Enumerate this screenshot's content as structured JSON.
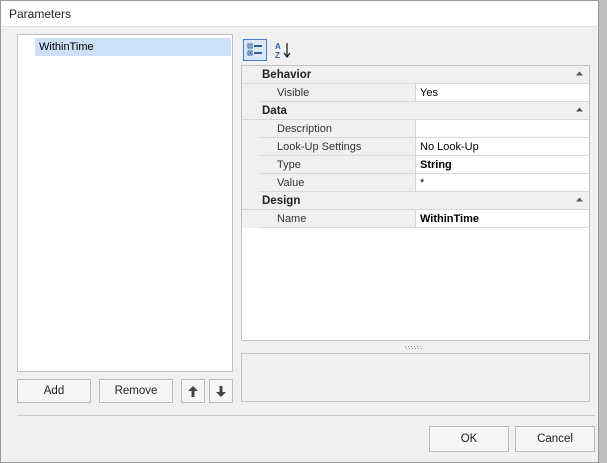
{
  "window": {
    "title": "Parameters"
  },
  "parameters_list": {
    "items": [
      "WithinTime"
    ]
  },
  "list_buttons": {
    "add": "Add",
    "remove": "Remove"
  },
  "toolbar": {
    "categorized_icon": "categorized-view-icon",
    "alphabetical_icon": "sort-alphabetical-icon"
  },
  "property_grid": {
    "categories": [
      {
        "name": "Behavior",
        "rows": [
          {
            "name": "Visible",
            "value": "Yes",
            "bold": false
          }
        ]
      },
      {
        "name": "Data",
        "rows": [
          {
            "name": "Description",
            "value": "",
            "bold": false
          },
          {
            "name": "Look-Up Settings",
            "value": "No Look-Up",
            "bold": false
          },
          {
            "name": "Type",
            "value": "String",
            "bold": true
          },
          {
            "name": "Value",
            "value": "*",
            "bold": false
          }
        ]
      },
      {
        "name": "Design",
        "rows": [
          {
            "name": "Name",
            "value": "WithinTime",
            "bold": true
          }
        ]
      }
    ]
  },
  "footer": {
    "ok": "OK",
    "cancel": "Cancel"
  },
  "colors": {
    "selection": "#cde0f7",
    "accent": "#3c7fd3",
    "window_bg": "#f0f0f0"
  }
}
